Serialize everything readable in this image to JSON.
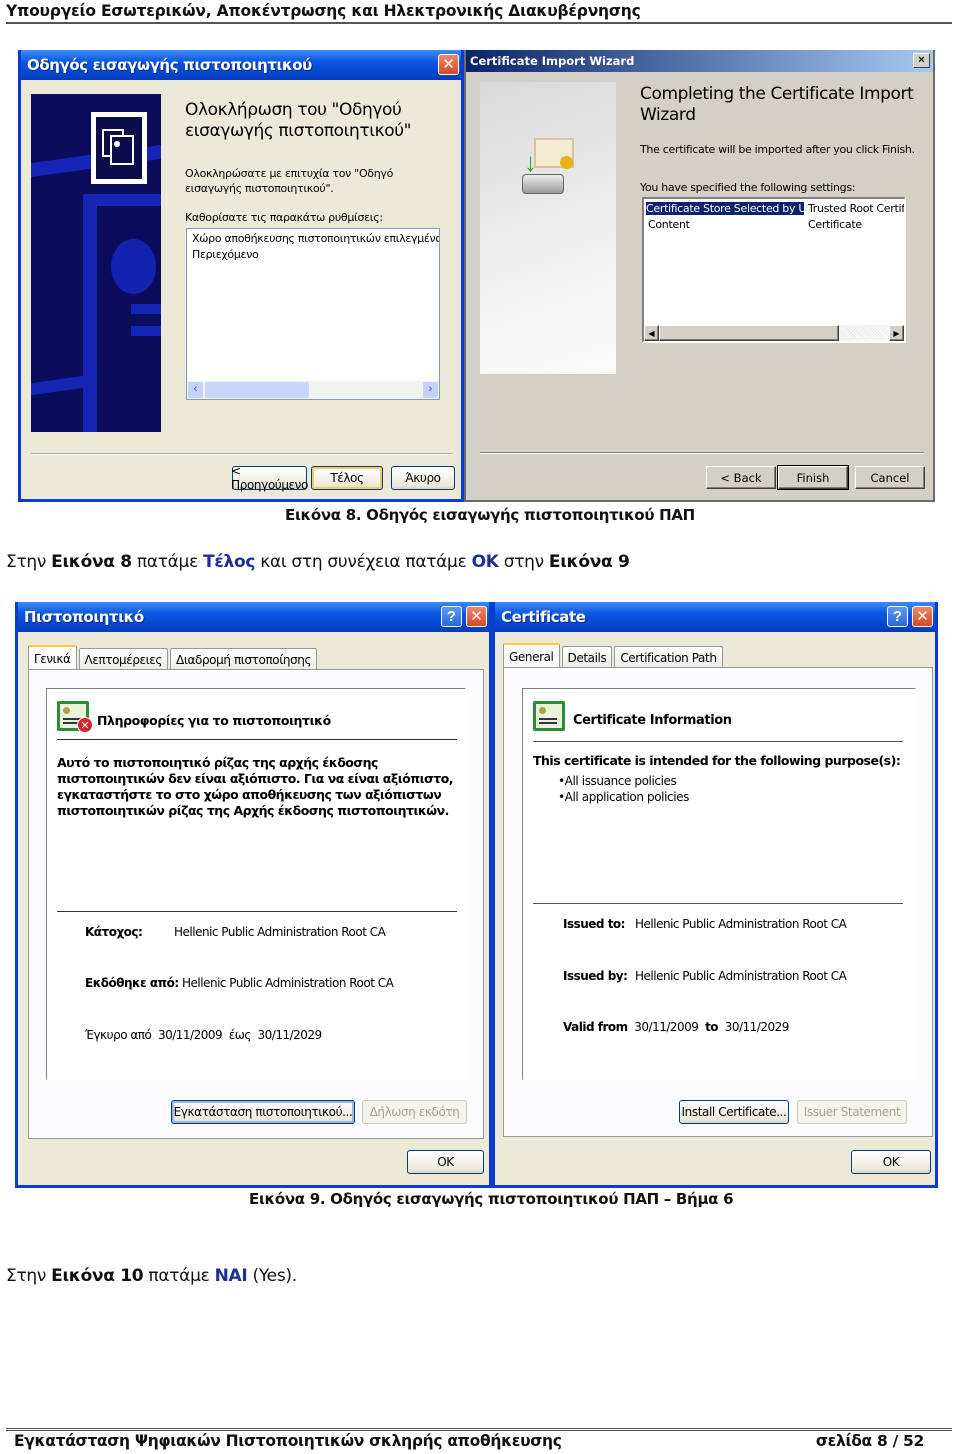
{
  "page": {
    "header": "Υπουργείο Εσωτερικών, Αποκέντρωσης και Ηλεκτρονικής Διακυβέρνησης",
    "footer_title": "Εγκατάσταση Ψηφιακών Πιστοποιητικών σκληρής αποθήκευσης",
    "footer_page": "σελίδα 8 / 52"
  },
  "figure8": {
    "caption": "Εικόνα 8. Οδηγός εισαγωγής πιστοποιητικού ΠΑΠ",
    "greek_wizard": {
      "title": "Οδηγός εισαγωγής πιστοποιητικού",
      "heading": "Ολοκλήρωση του \"Οδηγού εισαγωγής πιστοποιητικού\"",
      "success_text": "Ολοκληρώσατε με επιτυχία τον \"Οδηγό εισαγωγής πιστοποιητικού\".",
      "settings_label": "Καθορίσατε τις παρακάτω ρυθμίσεις:",
      "settings_rows": [
        "Χώρο αποθήκευσης πιστοποιητικών επιλεγμένος από το χρ",
        "Περιεχόμενο"
      ],
      "buttons": {
        "back": "< Προηγούμενο",
        "finish": "Τέλος",
        "cancel": "Άκυρο"
      },
      "icons": {
        "close": "close-icon",
        "scroll_left": "chevron-left-icon",
        "scroll_right": "chevron-right-icon"
      }
    },
    "english_wizard": {
      "title": "Certificate Import Wizard",
      "heading": "Completing the Certificate Import Wizard",
      "info_text": "The certificate will be imported after you click Finish.",
      "settings_label": "You have specified the following settings:",
      "settings_rows": [
        {
          "key": "Certificate Store Selected by User",
          "value": "Trusted Root Certifica"
        },
        {
          "key": "Content",
          "value": "Certificate"
        }
      ],
      "buttons": {
        "back": "< Back",
        "finish": "Finish",
        "cancel": "Cancel"
      },
      "close_glyph": "×"
    }
  },
  "instruction1": {
    "prefix": "Στην ",
    "fig_ref": "Εικόνα 8",
    "mid1": " πατάμε ",
    "action1": "Τέλος",
    "mid2": " και στη συνέχεια πατάμε ",
    "action2": "ΟΚ",
    "mid3": " στην ",
    "fig_ref2": "Εικόνα 9"
  },
  "figure9": {
    "caption": "Εικόνα 9. Οδηγός εισαγωγής πιστοποιητικού ΠΑΠ – Βήμα 6",
    "greek_cert": {
      "title": "Πιστοποιητικό",
      "tabs": [
        "Γενικά",
        "Λεπτομέρειες",
        "Διαδρομή πιστοποίησης"
      ],
      "info_title": "Πληροφορίες για το πιστοποιητικό",
      "warning": "Αυτό το πιστοποιητικό ρίζας της αρχής έκδοσης πιστοποιητικών δεν είναι αξιόπιστο. Για να είναι αξιόπιστο, εγκαταστήστε το στο χώρο αποθήκευσης των αξιόπιστων πιστοποιητικών ρίζας της Αρχής έκδοσης πιστοποιητικών.",
      "issued_to_label": "Κάτοχος:",
      "issued_to": "Hellenic Public Administration Root CA",
      "issued_by_label": "Εκδόθηκε από:",
      "issued_by": "Hellenic Public Administration Root CA",
      "valid_prefix": "Έγκυρο από",
      "valid_from": "30/11/2009",
      "valid_mid": "έως",
      "valid_to": "30/11/2029",
      "buttons": {
        "install": "Εγκατάσταση πιστοποιητικού...",
        "issuer": "Δήλωση εκδότη",
        "ok": "OK"
      },
      "help_glyph": "?",
      "close_glyph": "✕"
    },
    "english_cert": {
      "title": "Certificate",
      "tabs": [
        "General",
        "Details",
        "Certification Path"
      ],
      "info_title": "Certificate Information",
      "purpose_intro": "This certificate is intended for the following purpose(s):",
      "purposes": [
        "•All issuance policies",
        "•All application policies"
      ],
      "issued_to_label": "Issued to:",
      "issued_to": "Hellenic Public Administration Root CA",
      "issued_by_label": "Issued by:",
      "issued_by": "Hellenic Public Administration Root CA",
      "valid_prefix": "Valid from",
      "valid_from": "30/11/2009",
      "valid_mid": "to",
      "valid_to": "30/11/2029",
      "buttons": {
        "install": "Install Certificate...",
        "issuer": "Issuer Statement",
        "ok": "OK"
      },
      "help_glyph": "?",
      "close_glyph": "✕"
    }
  },
  "instruction2": {
    "prefix": "Στην ",
    "fig_ref": "Εικόνα 10",
    "mid": " πατάμε ",
    "action": "ΝΑΙ",
    "suffix": " (Yes)."
  },
  "colors": {
    "accent_blue": "#1d2d9a",
    "xp_title": "#0a56e0",
    "classic_title": "#0a246a"
  }
}
